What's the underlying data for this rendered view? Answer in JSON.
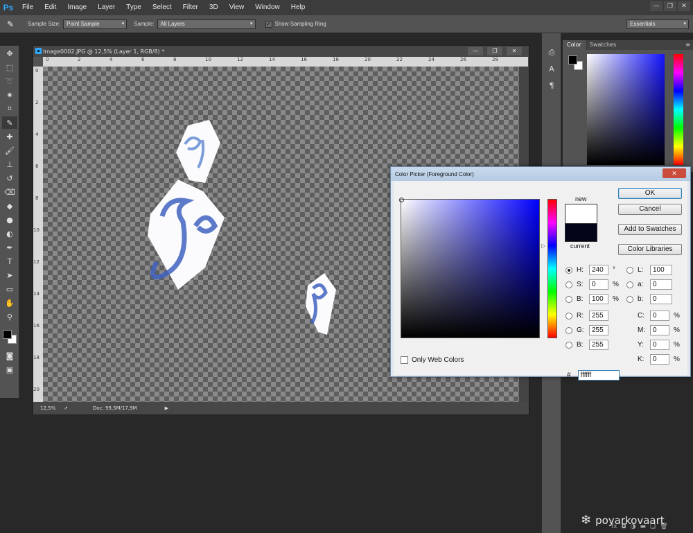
{
  "app": {
    "logo": "Ps"
  },
  "menu": [
    "File",
    "Edit",
    "Image",
    "Layer",
    "Type",
    "Select",
    "Filter",
    "3D",
    "View",
    "Window",
    "Help"
  ],
  "window_controls": {
    "minimize": "—",
    "restore": "❐",
    "close": "✕"
  },
  "options_bar": {
    "sample_size_label": "Sample Size:",
    "sample_size_value": "Point Sample",
    "sample_label": "Sample:",
    "sample_value": "All Layers",
    "show_ring_label": "Show Sampling Ring",
    "show_ring_checked": "✓",
    "workspace": "Essentials"
  },
  "document": {
    "title": "Image0002.JPG @ 12,5% (Layer 1, RGB/8) *",
    "zoom": "12,5%",
    "doc_info": "Doc: 99,5M/17,9M",
    "ruler_top": [
      "0",
      "2",
      "4",
      "6",
      "8",
      "10",
      "12",
      "14",
      "16",
      "18",
      "20",
      "22",
      "24",
      "26",
      "28"
    ],
    "ruler_left": [
      "0",
      "2",
      "4",
      "6",
      "8",
      "10",
      "12",
      "14",
      "16",
      "18",
      "20"
    ]
  },
  "panels": {
    "color_tab": "Color",
    "swatches_tab": "Swatches"
  },
  "dialog": {
    "title": "Color Picker (Foreground Color)",
    "close": "✕",
    "new_label": "new",
    "current_label": "current",
    "ok": "OK",
    "cancel": "Cancel",
    "add_to_swatches": "Add to Swatches",
    "color_libraries": "Color Libraries",
    "only_web_colors": "Only Web Colors",
    "hsb": [
      {
        "label": "H:",
        "value": "240",
        "unit": "°"
      },
      {
        "label": "S:",
        "value": "0",
        "unit": "%"
      },
      {
        "label": "B:",
        "value": "100",
        "unit": "%"
      }
    ],
    "rgb": [
      {
        "label": "R:",
        "value": "255"
      },
      {
        "label": "G:",
        "value": "255"
      },
      {
        "label": "B:",
        "value": "255"
      }
    ],
    "lab": [
      {
        "label": "L:",
        "value": "100"
      },
      {
        "label": "a:",
        "value": "0"
      },
      {
        "label": "b:",
        "value": "0"
      }
    ],
    "cmyk": [
      {
        "label": "C:",
        "value": "0",
        "unit": "%"
      },
      {
        "label": "M:",
        "value": "0",
        "unit": "%"
      },
      {
        "label": "Y:",
        "value": "0",
        "unit": "%"
      },
      {
        "label": "K:",
        "value": "0",
        "unit": "%"
      }
    ],
    "hex_label": "#",
    "hex_value": "ffffff",
    "new_color": "#ffffff",
    "current_color": "#05051a"
  },
  "watermark": {
    "text": "poyarkovaart",
    "icon": "snowflake-icon"
  }
}
